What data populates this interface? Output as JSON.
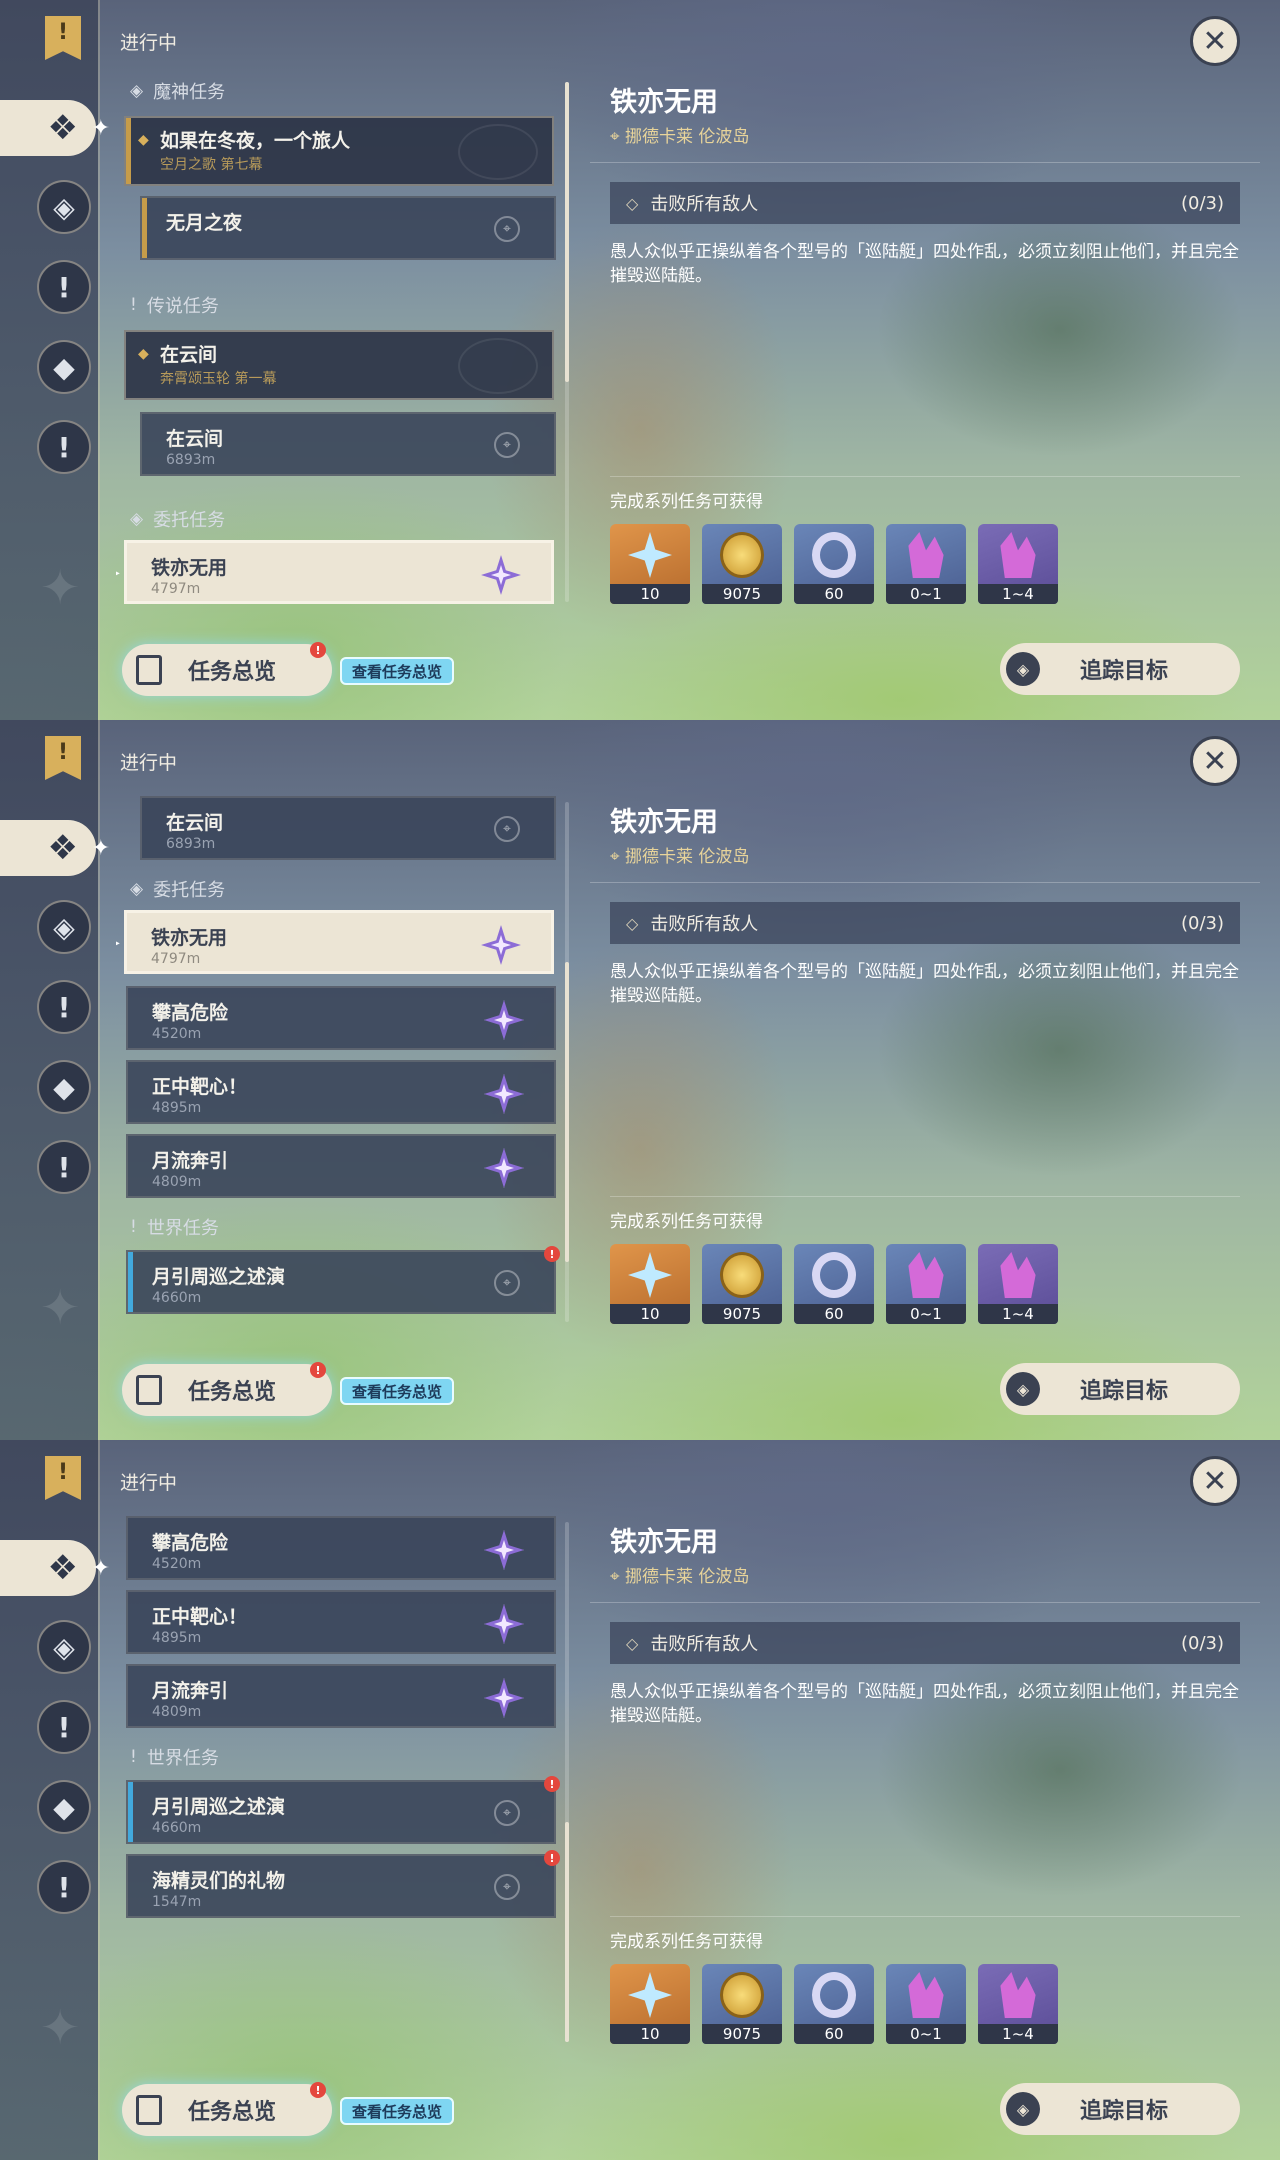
{
  "ongoing_label": "进行中",
  "sections": {
    "archon": "魔神任务",
    "legend": "传说任务",
    "commission": "委托任务",
    "world": "世界任务"
  },
  "quests": {
    "archon_head": {
      "title": "如果在冬夜，一个旅人",
      "sub": "空月之歌 第七幕"
    },
    "archon_step": {
      "title": "无月之夜"
    },
    "legend_head": {
      "title": "在云间",
      "sub": "奔霄颂玉轮 第一幕"
    },
    "legend_step": {
      "title": "在云间",
      "sub": "6893m"
    },
    "c1": {
      "title": "铁亦无用",
      "sub": "4797m"
    },
    "c2": {
      "title": "攀高危险",
      "sub": "4520m"
    },
    "c3": {
      "title": "正中靶心！",
      "sub": "4895m"
    },
    "c4": {
      "title": "月流奔引",
      "sub": "4809m"
    },
    "w1": {
      "title": "月引周巡之述演",
      "sub": "4660m"
    },
    "w2": {
      "title": "海精灵们的礼物",
      "sub": "1547m"
    }
  },
  "overview_label": "任务总览",
  "view_all_label": "查看任务总览",
  "detail": {
    "title": "铁亦无用",
    "location": "挪德卡莱 伦波岛",
    "objective": "击败所有敌人",
    "objective_count": "(0/3)",
    "description": "愚人众似乎正操纵着各个型号的「巡陆艇」四处作乱，必须立刻阻止他们，并且完全摧毁巡陆艇。",
    "reward_label": "完成系列任务可获得",
    "rewards": [
      "10",
      "9075",
      "60",
      "0~1",
      "1~4"
    ]
  },
  "track_label": "追踪目标",
  "colors": {
    "accent_gold": "#c69c4a",
    "cream": "#ece5d5",
    "alert_red": "#e4473d",
    "world_blue": "#42a9dd"
  }
}
